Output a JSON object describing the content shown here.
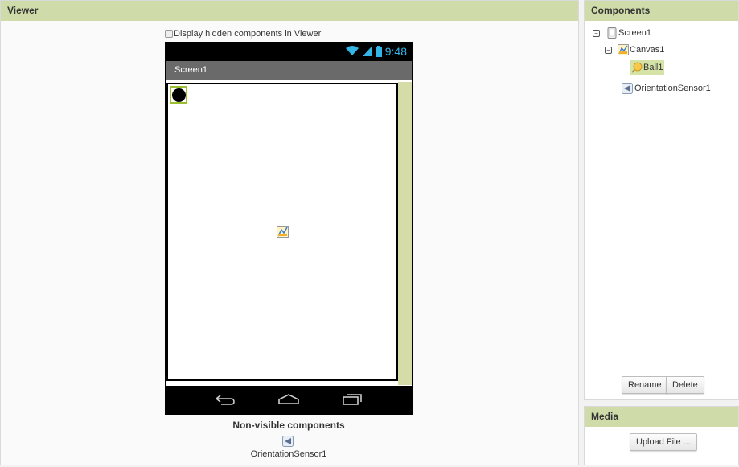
{
  "viewer": {
    "title": "Viewer",
    "hidden_toggle_label": "Display hidden components in Viewer",
    "phone": {
      "time": "9:48",
      "screen_title": "Screen1"
    },
    "nonvisible_title": "Non-visible components",
    "nonvisible_items": [
      "OrientationSensor1"
    ]
  },
  "components": {
    "title": "Components",
    "tree": {
      "screen": "Screen1",
      "canvas": "Canvas1",
      "ball": "Ball1",
      "sensor": "OrientationSensor1"
    },
    "rename_label": "Rename",
    "delete_label": "Delete"
  },
  "media": {
    "title": "Media",
    "upload_label": "Upload File ..."
  },
  "colors": {
    "header_bg": "#cfdcaa",
    "selected_bg": "#d5e3a7",
    "status_accent": "#33b5e5"
  }
}
